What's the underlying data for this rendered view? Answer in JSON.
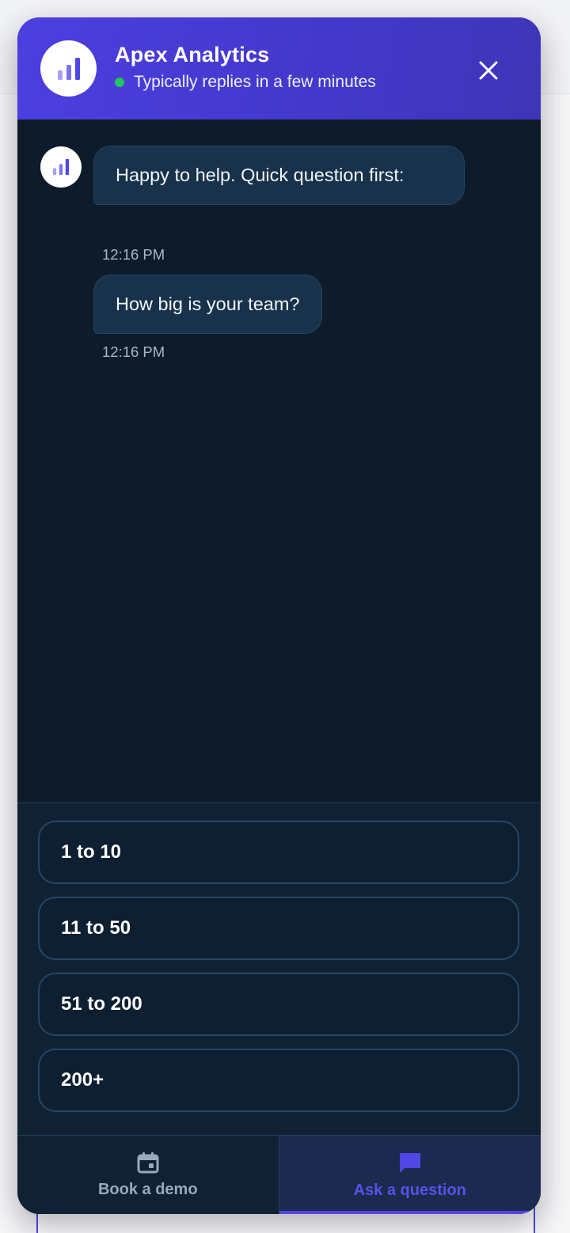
{
  "header": {
    "title": "Apex Analytics",
    "status": "Typically replies in a few minutes",
    "status_color": "#22c55e",
    "avatar_icon": "bar-chart-icon",
    "close_icon": "close-icon"
  },
  "messages": [
    {
      "text": "Happy to help. Quick question first:",
      "time": "12:16 PM"
    },
    {
      "text": "How big is your team?",
      "time": "12:16 PM"
    }
  ],
  "options": [
    {
      "label": "1 to 10"
    },
    {
      "label": "11 to 50"
    },
    {
      "label": "51 to 200"
    },
    {
      "label": "200+"
    }
  ],
  "tabs": [
    {
      "label": "Book a demo",
      "icon": "calendar-icon",
      "active": false
    },
    {
      "label": "Ask a question",
      "icon": "chat-bubble-icon",
      "active": true
    }
  ],
  "colors": {
    "brand": "#4f46e5",
    "panel_bg": "#0d1b2a",
    "bubble_bg": "#17324a"
  }
}
